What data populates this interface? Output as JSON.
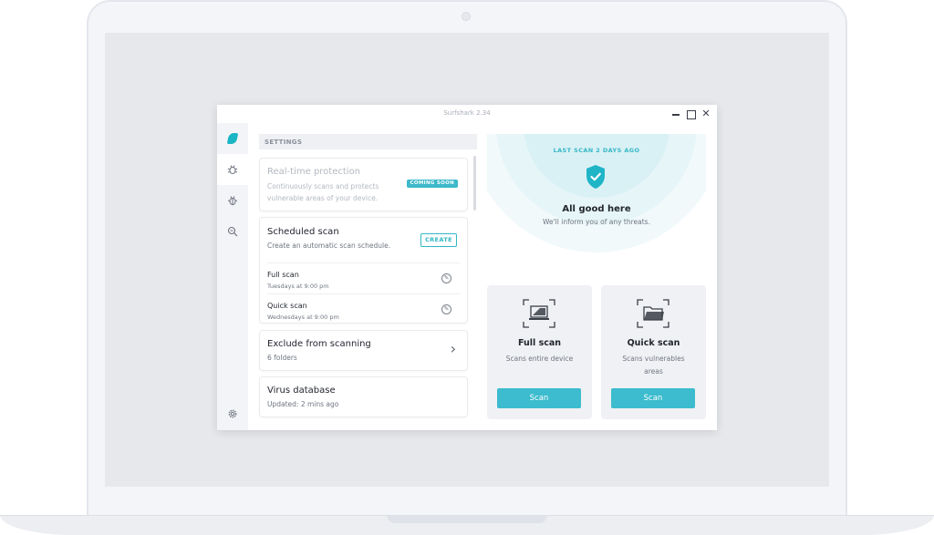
{
  "window": {
    "title": "Surfshark 2.34"
  },
  "sidebar": {
    "items": [
      {
        "icon": "surfshark-logo"
      },
      {
        "icon": "bug-settings-icon"
      },
      {
        "icon": "bug-icon"
      },
      {
        "icon": "search-zoom-icon"
      },
      {
        "icon": "gear-icon"
      }
    ]
  },
  "settings": {
    "header": "SETTINGS",
    "realtime": {
      "title": "Real-time protection",
      "subtitle": "Continuously scans and protects vulnerable areas of your device.",
      "badge": "COMING SOON"
    },
    "scheduled": {
      "title": "Scheduled scan",
      "subtitle": "Create an automatic scan schedule.",
      "create_label": "CREATE",
      "rows": [
        {
          "title": "Full scan",
          "time": "Tuesdays at 9:00 pm"
        },
        {
          "title": "Quick scan",
          "time": "Wednesdays at 9:00 pm"
        }
      ]
    },
    "exclude": {
      "title": "Exclude from scanning",
      "subtitle": "6 folders"
    },
    "virus_db": {
      "title": "Virus database",
      "subtitle": "Updated: 2 mins ago"
    }
  },
  "status": {
    "last_scan": "LAST SCAN 2 DAYS AGO",
    "title": "All good here",
    "subtitle": "We'll inform you of any threats."
  },
  "scans": {
    "full": {
      "title": "Full scan",
      "description": "Scans entire device",
      "button": "Scan"
    },
    "quick": {
      "title": "Quick scan",
      "description": "Scans vulnerables areas",
      "button": "Scan"
    }
  },
  "colors": {
    "accent": "#3cbcce",
    "badge": "#3cb8c9"
  }
}
